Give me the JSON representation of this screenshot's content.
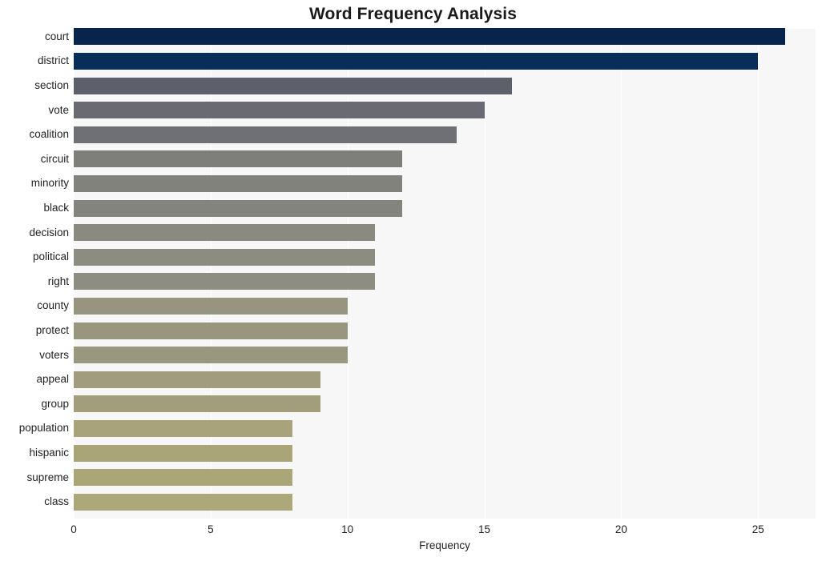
{
  "chart_data": {
    "type": "bar",
    "orientation": "horizontal",
    "title": "Word Frequency Analysis",
    "xlabel": "Frequency",
    "ylabel": "",
    "xlim": [
      0,
      27.1
    ],
    "ylim": null,
    "grid": true,
    "grid_axis": "x",
    "legend": false,
    "xticks": [
      0,
      5,
      10,
      15,
      20,
      25
    ],
    "xtick_labels": [
      "0",
      "5",
      "10",
      "15",
      "20",
      "25"
    ],
    "categories": [
      "court",
      "district",
      "section",
      "vote",
      "coalition",
      "circuit",
      "minority",
      "black",
      "decision",
      "political",
      "right",
      "county",
      "protect",
      "voters",
      "appeal",
      "group",
      "population",
      "hispanic",
      "supreme",
      "class"
    ],
    "values": [
      26,
      25,
      16,
      15,
      14,
      12,
      12,
      12,
      11,
      11,
      11,
      10,
      10,
      10,
      9,
      9,
      8,
      8,
      8,
      8
    ],
    "bar_colors": [
      "#08244c",
      "#092d59",
      "#5d5f6b",
      "#696a72",
      "#6f7076",
      "#7e7e7b",
      "#82827d",
      "#84847e",
      "#8b8a80",
      "#8d8c81",
      "#8e8d82",
      "#97947f",
      "#99967f",
      "#9a977f",
      "#a09c7d",
      "#a29e7c",
      "#a8a37a",
      "#aaa579",
      "#aba678",
      "#ada87a"
    ],
    "plot_background": "#f7f7f7",
    "grid_color": "#ffffff",
    "figure_background": "#ffffff",
    "text_color": "#222222",
    "title_color": "#1a1a1a"
  }
}
